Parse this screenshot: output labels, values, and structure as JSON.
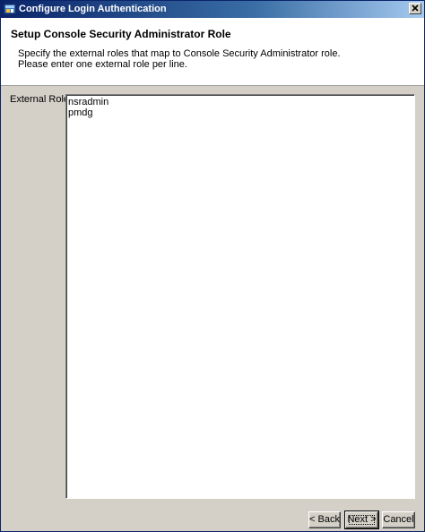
{
  "window": {
    "title": "Configure Login Authentication"
  },
  "header": {
    "title": "Setup Console Security Administrator Role",
    "description_lines": [
      "Specify the external roles that map to Console Security Administrator role.",
      "Please enter one external role per line."
    ]
  },
  "form": {
    "external_roles_label": "External Roles:",
    "external_roles": [
      "nsradmin",
      "pmdg"
    ]
  },
  "buttons": {
    "back": "< Back",
    "next": "Next >",
    "cancel": "Cancel"
  },
  "icons": {
    "app": "app-window-icon",
    "close": "close-icon"
  },
  "colors": {
    "titlebar_start": "#0a246a",
    "titlebar_end": "#a6caf0",
    "dialog_background": "#d4d0c8"
  }
}
